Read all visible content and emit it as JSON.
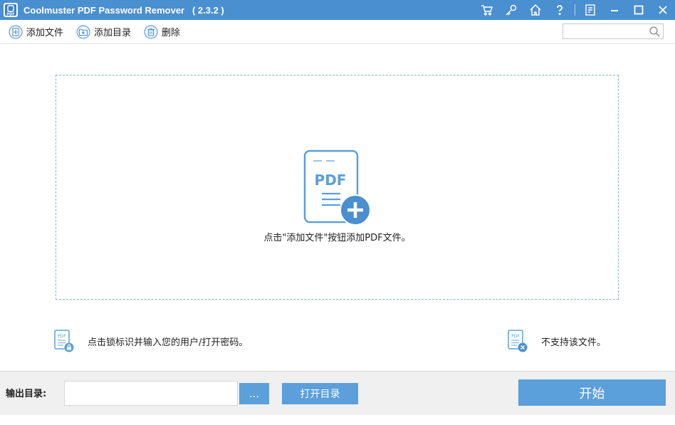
{
  "window": {
    "title": "Coolmuster PDF Password Remover   ( 2.3.2 )",
    "title_icons": [
      "cart-icon",
      "key-icon",
      "home-icon",
      "help-icon",
      "feedback-icon",
      "minimize-icon",
      "maximize-icon",
      "close-icon"
    ]
  },
  "toolbar": {
    "add_file_label": "添加文件",
    "add_folder_label": "添加目录",
    "delete_label": "删除"
  },
  "search": {
    "value": "",
    "placeholder": ""
  },
  "dropzone": {
    "hint": "点击\"添加文件\"按钮添加PDF文件。"
  },
  "legend": {
    "lock_text": "点击锁标识并输入您的用户/打开密码。",
    "unsupported_text": "不支持该文件。"
  },
  "output": {
    "label": "输出目录:",
    "path_value": "",
    "browse_label": "...",
    "open_folder_label": "打开目录",
    "start_label": "开始"
  },
  "colors": {
    "titlebar": "#4a8fd0",
    "button": "#5b9fdb",
    "dropzone_border": "#7fb4da",
    "icon_blue": "#4a8fd0"
  }
}
